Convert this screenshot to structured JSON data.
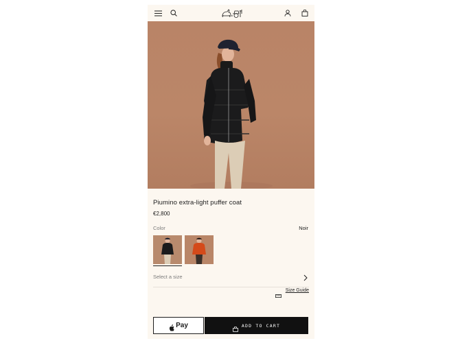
{
  "header": {
    "icons": [
      "menu-icon",
      "search-icon",
      "horse-carriage-logo",
      "account-icon",
      "shopping-bag-icon"
    ]
  },
  "hero": {
    "image": "model wearing black puffer coat and navy cap against terracotta background",
    "carousel_page": 1
  },
  "product": {
    "name": "Piumino extra-light puffer coat",
    "price": "€2,800",
    "color_label": "Color",
    "color_value": "Noir",
    "swatches": [
      "black",
      "orange"
    ],
    "size_placeholder": "Select a size",
    "size_guide": "Size Guide"
  },
  "actions": {
    "pay_label": "Pay",
    "add_to_cart": "ADD TO CART"
  },
  "colors": {
    "background": "#fcf7f0",
    "hero": "#b98467",
    "button": "#111111"
  }
}
